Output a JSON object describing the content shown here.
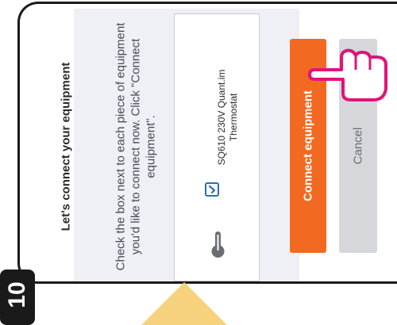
{
  "step": {
    "number": "10"
  },
  "screen": {
    "title": "Let's connect your equipment",
    "instruction": "Check the box next to each piece of equipment you'd like to connect now. Click \"Connect equipment\"."
  },
  "equipment": {
    "name_line1": "SQ610 230V Quant.im",
    "name_line2": "Thermostat",
    "checked": true,
    "icon": "thermostat-icon"
  },
  "buttons": {
    "connect_label": "Connect equipment",
    "cancel_label": "Cancel"
  },
  "colors": {
    "accent": "#f26a22",
    "checkbox": "#2a6fb8",
    "pointer_highlight": "#e0147a",
    "arrow": "#f7d27e"
  },
  "annotations": {
    "pointer": "hand-pointer-icon",
    "arrow": "triangle-pointer-icon"
  }
}
